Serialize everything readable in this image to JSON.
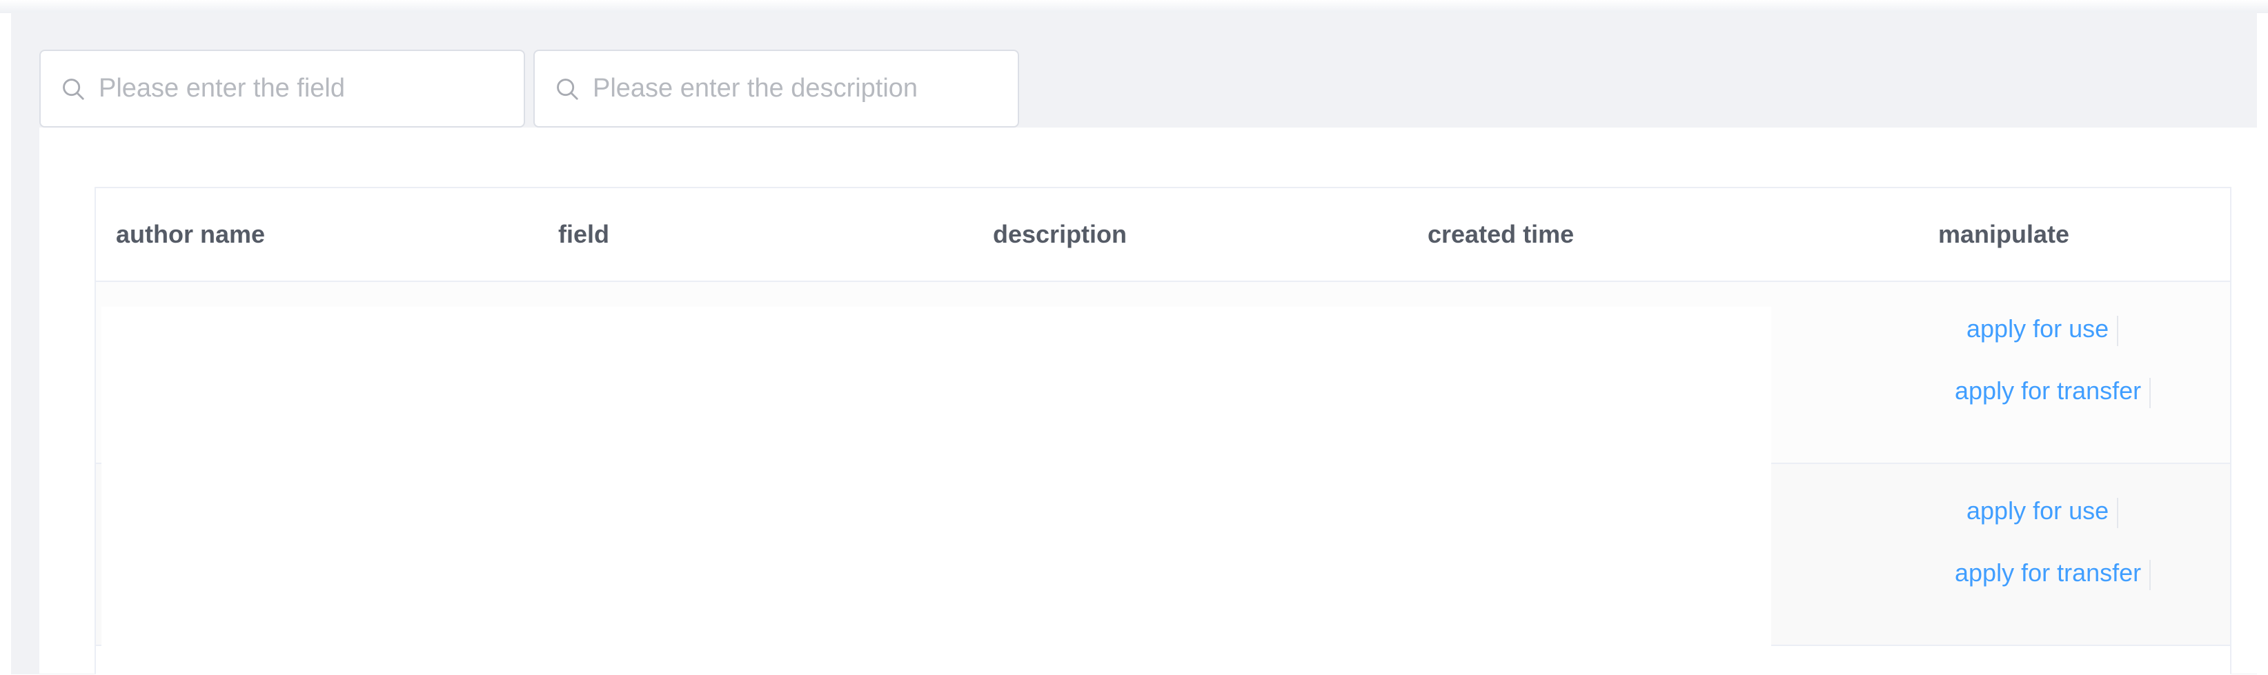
{
  "search": {
    "field_placeholder": "Please enter the field",
    "description_placeholder": "Please enter the description"
  },
  "table": {
    "columns": [
      "author name",
      "field",
      "description",
      "created time",
      "manipulate"
    ],
    "rows": [
      {
        "author_name": "",
        "field": "",
        "description": "",
        "created_time": "",
        "actions": [
          "apply for use",
          "apply for transfer"
        ]
      },
      {
        "author_name": "",
        "field": "",
        "description": "",
        "created_time": "",
        "actions": [
          "apply for use",
          "apply for transfer"
        ]
      }
    ]
  },
  "icons": {
    "search": "search-icon"
  },
  "colors": {
    "link": "#409eff",
    "background_panel": "#f1f2f5",
    "header_text": "#555b66",
    "placeholder": "#b6b9bf"
  }
}
